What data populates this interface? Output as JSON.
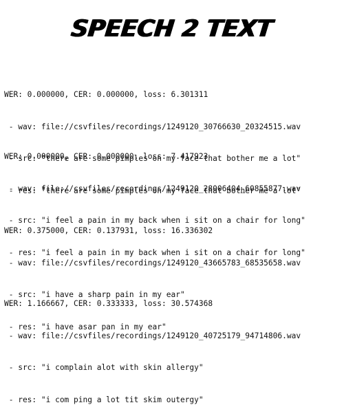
{
  "title": "SPEECH 2 TEXT",
  "results": [
    {
      "metrics": "WER: 0.000000, CER: 0.000000, loss: 6.301311",
      "wav": " - wav: file://csvfiles/recordings/1249120_30766630_20324515.wav",
      "src": " - src: \"there are some pimples on my face that bother me a lot\"",
      "res": " - res: \"there are some pimples on my face that bother me a lot\""
    },
    {
      "metrics": "WER: 0.000000, CER: 0.000000, loss: 7.417923",
      "wav": " - wav: file://csvfiles/recordings/1249120_28006404_60855877.wav",
      "src": " - src: \"i feel a pain in my back when i sit on a chair for long\"",
      "res": " - res: \"i feel a pain in my back when i sit on a chair for long\""
    },
    {
      "metrics": "WER: 0.375000, CER: 0.137931, loss: 16.336302",
      "wav": " - wav: file://csvfiles/recordings/1249120_43665783_68535658.wav",
      "src": " - src: \"i have a sharp pain in my ear\"",
      "res": " - res: \"i have asar pan in my ear\""
    },
    {
      "metrics": "WER: 1.166667, CER: 0.333333, loss: 30.574368",
      "wav": " - wav: file://csvfiles/recordings/1249120_40725179_94714806.wav",
      "src": " - src: \"i complain alot with skin allergy\"",
      "res": " - res: \"i com ping a lot tit skim outergy\""
    }
  ]
}
